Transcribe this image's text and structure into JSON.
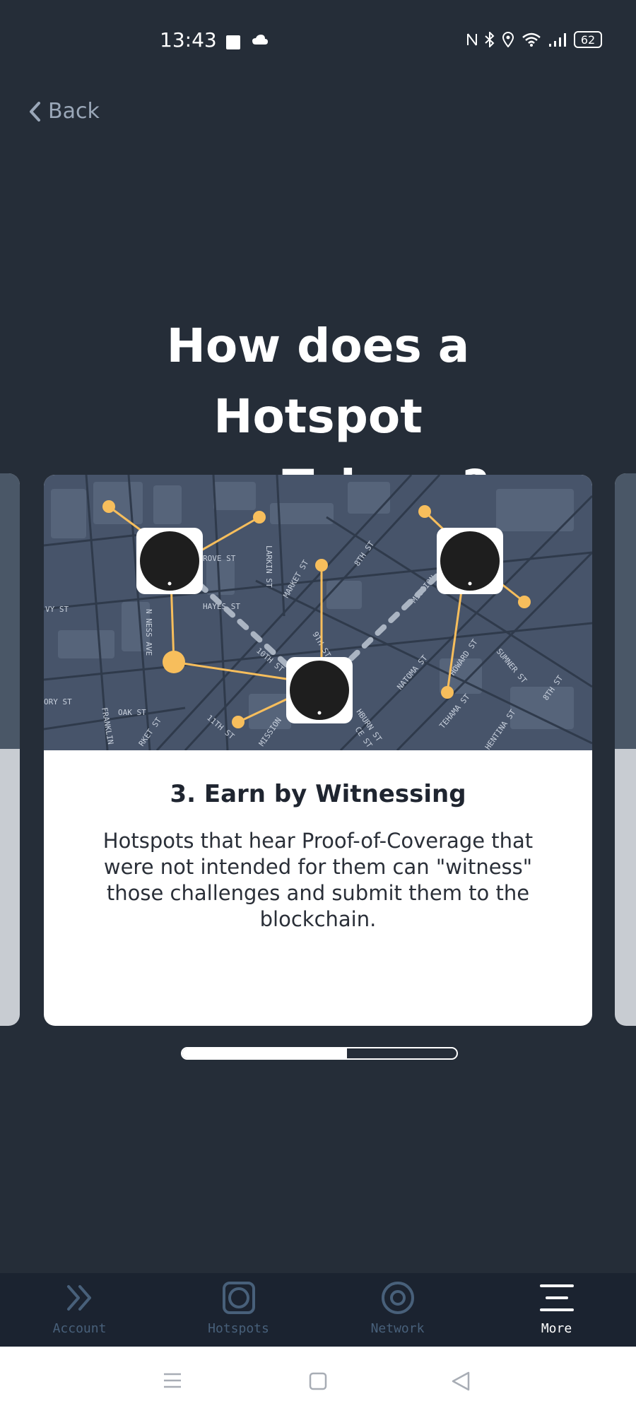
{
  "status": {
    "time": "13:43",
    "battery": "62"
  },
  "nav": {
    "back_label": "Back"
  },
  "headline": {
    "line1": "How does a Hotspot",
    "line2": "earn Tokens?"
  },
  "card": {
    "title": "3. Earn by Witnessing",
    "body": "Hotspots that hear Proof-of-Coverage that were not intended for them can \"witness\" those challenges and submit them to the blockchain."
  },
  "map_labels": {
    "grove": "ROVE ST",
    "larkin": "LARKIN ST",
    "hayes": "HAYES ST",
    "market1": "MARKET ST",
    "ninth_a": "9TH ST",
    "eighth": "8TH ST",
    "mission1": "MISSION",
    "van_ness": "N NESS AVE",
    "ivy": "VY ST",
    "tenth": "10TH ST",
    "natoma": "NATOMA ST",
    "howard": "HOWARD ST",
    "sumner": "SUMNER ST",
    "ory": "ORY ST",
    "oak": "OAK ST",
    "franklin": "FRANKLIN",
    "market2": "RKET ST",
    "eleventh": "11TH ST",
    "mission2": "MISSION",
    "washburn": "HBURN ST",
    "ce": "CE ST",
    "tehama": "TEHAMA ST",
    "clementina": "HENTINA ST",
    "eighth2": "8TH ST"
  },
  "progress": {
    "fraction": 0.6
  },
  "tabs": [
    {
      "label": "Account",
      "icon": "chevrons-right-icon"
    },
    {
      "label": "Hotspots",
      "icon": "hotspot-icon"
    },
    {
      "label": "Network",
      "icon": "target-icon"
    },
    {
      "label": "More",
      "icon": "menu-icon"
    }
  ],
  "colors": {
    "background": "#252d38",
    "accent": "#f7be5c",
    "map": "#47546a",
    "tab_inactive": "#48607a"
  }
}
